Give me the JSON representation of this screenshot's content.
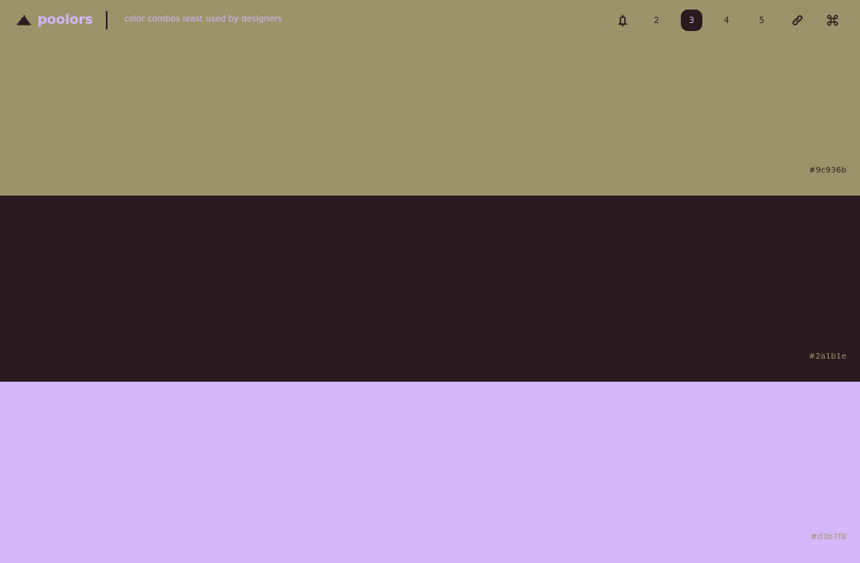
{
  "header": {
    "logo_text": "poolors",
    "tagline": "color combos least used by designers"
  },
  "nav": {
    "lock_icon": "lock-icon",
    "counts": [
      "2",
      "3",
      "4",
      "5"
    ],
    "active_count": "3",
    "link_icon": "link-icon",
    "shortcut_icon": "command-key-icon"
  },
  "palette": [
    {
      "hex": "#9c936b",
      "label": "#9c936b",
      "label_color": "#2a1b1e"
    },
    {
      "hex": "#2a1b1e",
      "label": "#2a1b1e",
      "label_color": "#9c936b"
    },
    {
      "hex": "#d3b7f8",
      "label": "#d3b7f8",
      "label_color": "#9c936b"
    }
  ],
  "colors": {
    "ui_text": "#2a1b1e",
    "accent": "#d3b7f8"
  }
}
